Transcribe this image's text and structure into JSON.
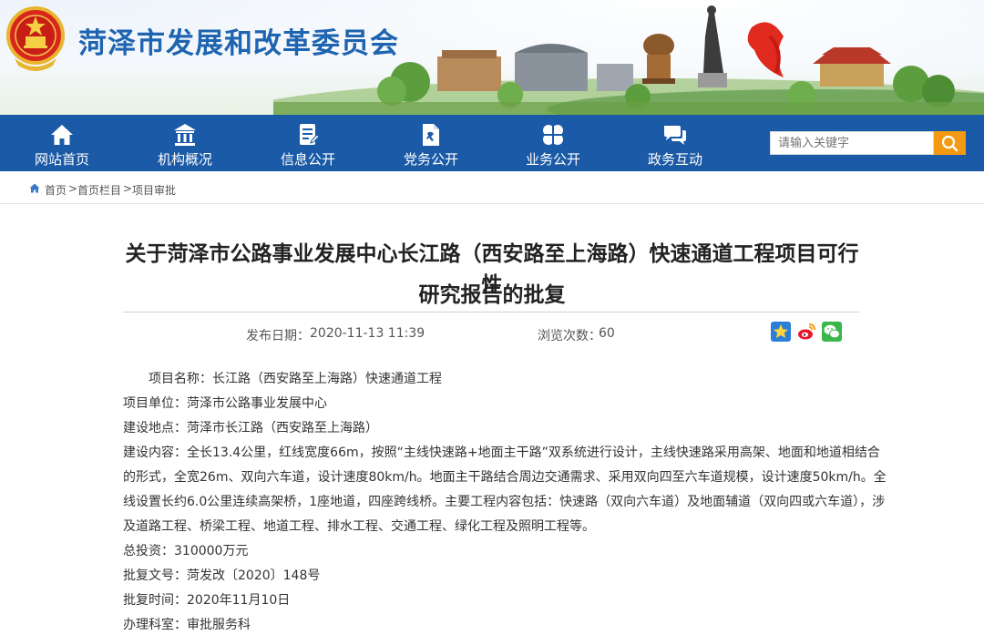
{
  "header": {
    "site_title": "菏泽市发展和改革委员会"
  },
  "nav": {
    "items": [
      {
        "label": "网站首页",
        "icon": "home-icon"
      },
      {
        "label": "机构概况",
        "icon": "building-icon"
      },
      {
        "label": "信息公开",
        "icon": "document-icon"
      },
      {
        "label": "党务公开",
        "icon": "party-doc-icon"
      },
      {
        "label": "业务公开",
        "icon": "clover-icon"
      },
      {
        "label": "政务互动",
        "icon": "chat-icon"
      }
    ],
    "search_placeholder": "请输入关键字"
  },
  "breadcrumb": [
    "首页",
    "首页栏目",
    "项目审批"
  ],
  "article": {
    "title_line1": "关于菏泽市公路事业发展中心长江路（西安路至上海路）快速通道工程项目可行性",
    "title_line2": "研究报告的批复",
    "publish_label": "发布日期：",
    "publish_date": "2020-11-13 11:39",
    "views_label": "浏览次数：",
    "views": "60",
    "share_icons": [
      "qzone-icon",
      "weibo-icon",
      "wechat-icon"
    ],
    "body": [
      "项目名称：长江路（西安路至上海路）快速通道工程",
      "项目单位：菏泽市公路事业发展中心",
      "建设地点：菏泽市长江路（西安路至上海路）",
      "建设内容：全长13.4公里，红线宽度66m，按照“主线快速路+地面主干路”双系统进行设计，主线快速路采用高架、地面和地道相结合",
      "的形式，全宽26m、双向六车道，设计速度80km/h。地面主干路结合周边交通需求、采用双向四至六车道规模，设计速度50km/h。全",
      "线设置长约6.0公里连续高架桥，1座地道，四座跨线桥。主要工程内容包括：快速路（双向六车道）及地面辅道（双向四或六车道），涉",
      "及道路工程、桥梁工程、地道工程、排水工程、交通工程、绿化工程及照明工程等。",
      "总投资：310000万元",
      "批复文号：菏发改〔2020〕148号",
      "批复时间：2020年11月10日",
      "办理科室：审批服务科"
    ]
  },
  "colors": {
    "nav_bg": "#1b5aa6",
    "title_blue": "#1f64b0",
    "search_orange": "#f39a12"
  }
}
